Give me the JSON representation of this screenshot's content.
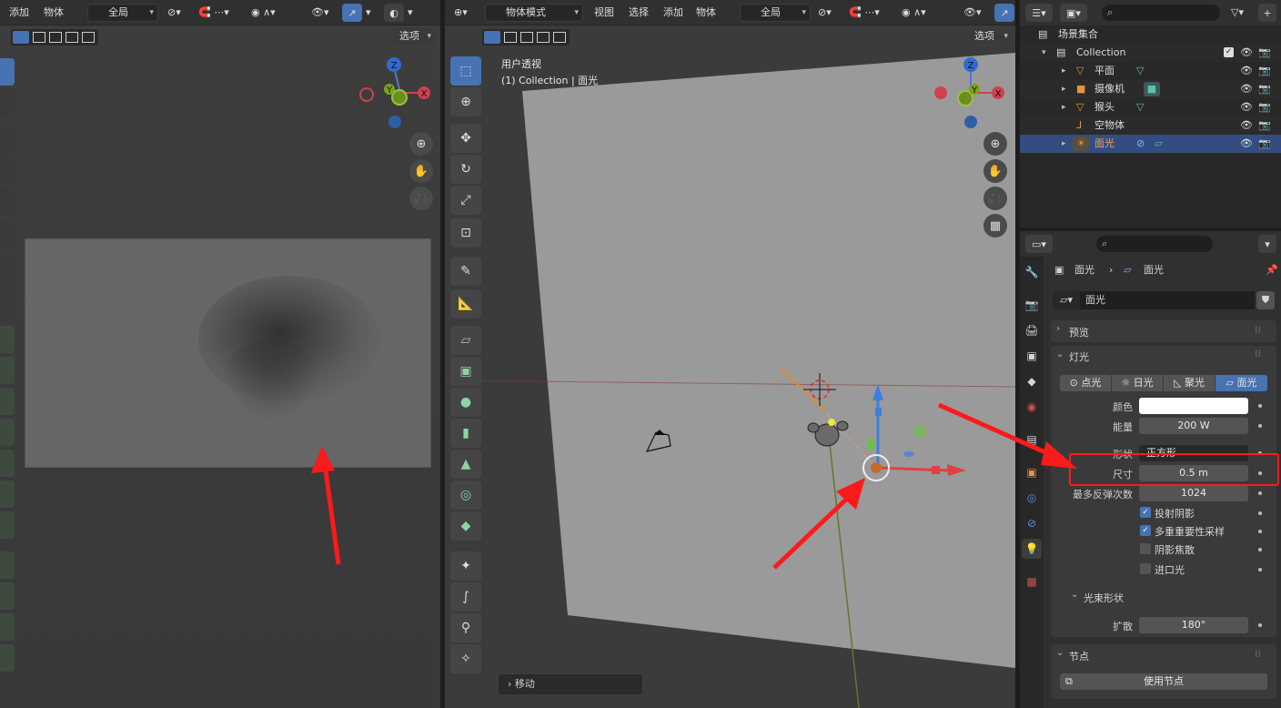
{
  "left_viewport": {
    "menu": [
      "添加",
      "物体"
    ],
    "orientation": "全局",
    "options_label": "选项",
    "gizmo": {
      "z": "Z",
      "y": "Y",
      "x": "X"
    }
  },
  "mid_viewport": {
    "mode": "物体模式",
    "menu": [
      "视图",
      "选择",
      "添加",
      "物体"
    ],
    "orientation": "全局",
    "options_label": "选项",
    "view_name": "用户透视",
    "view_info": "(1) Collection | 面光",
    "last_op": "移动",
    "gizmo": {
      "z": "Z",
      "y": "Y",
      "x": "X"
    }
  },
  "outliner": {
    "root": "场景集合",
    "collection": "Collection",
    "items": [
      {
        "name": "平面",
        "icon": "mesh-icon"
      },
      {
        "name": "摄像机",
        "icon": "camera-icon"
      },
      {
        "name": "猴头",
        "icon": "mesh-icon"
      },
      {
        "name": "空物体",
        "icon": "empty-icon"
      },
      {
        "name": "面光",
        "icon": "light-icon",
        "selected": true
      }
    ]
  },
  "properties": {
    "breadcrumb": {
      "object": "面光",
      "data": "面光"
    },
    "datablock_name": "面光",
    "preview_label": "预览",
    "light_panel_label": "灯光",
    "light_types": [
      "点光",
      "日光",
      "聚光",
      "面光"
    ],
    "active_type": "面光",
    "color_label": "颜色",
    "color_value": "#ffffff",
    "power_label": "能量",
    "power_value": "200 W",
    "shape_label": "形状",
    "shape_value": "正方形",
    "size_label": "尺寸",
    "size_value": "0.5 m",
    "bounces_label": "最多反弹次数",
    "bounces_value": "1024",
    "cast_shadow": "投射阴影",
    "mis": "多重重要性采样",
    "shadow_caustics": "阴影焦散",
    "portal": "进口光",
    "beam_label": "光束形状",
    "spread_label": "扩散",
    "spread_value": "180°",
    "nodes_label": "节点",
    "use_nodes": "使用节点"
  },
  "colors": {
    "accent": "#4772b3",
    "annotation": "#ff1a1a"
  }
}
